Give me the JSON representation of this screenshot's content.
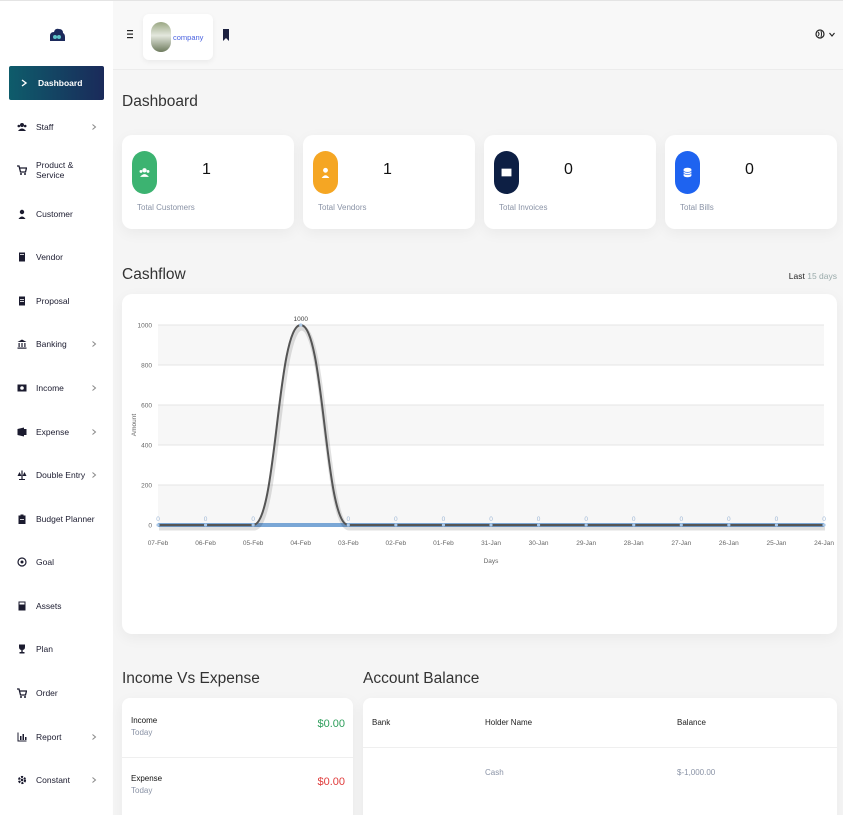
{
  "sidebar": {
    "items": [
      {
        "label": "Dashboard",
        "icon": "chevron-right-icon",
        "active": true,
        "has_submenu": false
      },
      {
        "label": "Staff",
        "icon": "users-icon",
        "has_submenu": true
      },
      {
        "label": "Product & Service",
        "icon": "cart-icon",
        "has_submenu": false
      },
      {
        "label": "Customer",
        "icon": "user-icon",
        "has_submenu": false
      },
      {
        "label": "Vendor",
        "icon": "note-icon",
        "has_submenu": false
      },
      {
        "label": "Proposal",
        "icon": "file-icon",
        "has_submenu": false
      },
      {
        "label": "Banking",
        "icon": "bank-icon",
        "has_submenu": true
      },
      {
        "label": "Income",
        "icon": "money-icon",
        "has_submenu": true
      },
      {
        "label": "Expense",
        "icon": "wallet-icon",
        "has_submenu": true
      },
      {
        "label": "Double Entry",
        "icon": "scale-icon",
        "has_submenu": true
      },
      {
        "label": "Budget Planner",
        "icon": "clipboard-icon",
        "has_submenu": false
      },
      {
        "label": "Goal",
        "icon": "target-icon",
        "has_submenu": false
      },
      {
        "label": "Assets",
        "icon": "calculator-icon",
        "has_submenu": false
      },
      {
        "label": "Plan",
        "icon": "trophy-icon",
        "has_submenu": false
      },
      {
        "label": "Order",
        "icon": "cart-icon",
        "has_submenu": false
      },
      {
        "label": "Report",
        "icon": "chart-icon",
        "has_submenu": true
      },
      {
        "label": "Constant",
        "icon": "gear-icon",
        "has_submenu": true
      }
    ]
  },
  "header": {
    "company": "company"
  },
  "page": {
    "title": "Dashboard"
  },
  "stats": [
    {
      "value": "1",
      "label": "Total Customers",
      "color": "#3cb371",
      "icon": "users-icon"
    },
    {
      "value": "1",
      "label": "Total Vendors",
      "color": "#f5a623",
      "icon": "user-icon"
    },
    {
      "value": "0",
      "label": "Total Invoices",
      "color": "#0d1f44",
      "icon": "money-icon"
    },
    {
      "value": "0",
      "label": "Total Bills",
      "color": "#1e63f0",
      "icon": "database-icon"
    }
  ],
  "cashflow": {
    "title": "Cashflow",
    "last_prefix": "Last",
    "last_value": "15 days"
  },
  "chart_data": {
    "type": "line",
    "x": [
      "07-Feb",
      "06-Feb",
      "05-Feb",
      "04-Feb",
      "03-Feb",
      "02-Feb",
      "01-Feb",
      "31-Jan",
      "30-Jan",
      "29-Jan",
      "28-Jan",
      "27-Jan",
      "26-Jan",
      "25-Jan",
      "24-Jan"
    ],
    "series": [
      {
        "values": [
          0,
          0,
          0,
          1000,
          0,
          0,
          0,
          0,
          0,
          0,
          0,
          0,
          0,
          0,
          0
        ],
        "color": "#555555"
      },
      {
        "values": [
          0,
          0,
          0,
          0,
          0,
          0,
          0,
          0,
          0,
          0,
          0,
          0,
          0,
          0,
          0
        ],
        "color": "#7aa7d6"
      }
    ],
    "data_labels": [
      "0",
      "0",
      "0",
      "1000",
      "0",
      "0",
      "0",
      "0",
      "0",
      "0",
      "0",
      "0",
      "0",
      "0",
      "0"
    ],
    "xlabel": "Days",
    "ylabel": "Amount",
    "ylim": [
      0,
      1000
    ],
    "yticks": [
      "0",
      "200",
      "400",
      "600",
      "800",
      "1000"
    ],
    "grid": true
  },
  "income_expense": {
    "title": "Income Vs Expense",
    "rows": [
      {
        "label": "Income",
        "sub": "Today",
        "amount": "$0.00",
        "color": "#2e9e5b"
      },
      {
        "label": "Expense",
        "sub": "Today",
        "amount": "$0.00",
        "color": "#e03b3b"
      }
    ]
  },
  "account_balance": {
    "title": "Account Balance",
    "columns": [
      "Bank",
      "Holder Name",
      "Balance"
    ],
    "rows": [
      {
        "bank": "",
        "holder": "Cash",
        "balance": "$-1,000.00"
      }
    ]
  }
}
